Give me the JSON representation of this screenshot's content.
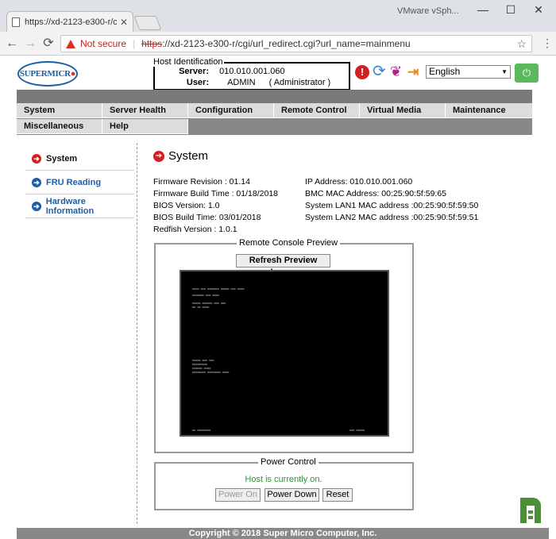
{
  "browser": {
    "tab_title": "https://xd-2123-e300-r/c",
    "user_label": "VMware vSph...",
    "security_label": "Not secure",
    "url_scheme": "https",
    "url_rest": "://xd-2123-e300-r/cgi/url_redirect.cgi?url_name=mainmenu"
  },
  "logo_text": "SUPERMICR",
  "host": {
    "legend": "Host Identification",
    "server_label": "Server:",
    "server_value": "010.010.001.060",
    "user_label": "User:",
    "user_value": "ADMIN",
    "user_role": "( Administrator )"
  },
  "language": {
    "selected": "English"
  },
  "menu": {
    "row1": [
      "System",
      "Server Health",
      "Configuration",
      "Remote Control",
      "Virtual Media",
      "Maintenance"
    ],
    "row2": [
      "Miscellaneous",
      "Help"
    ]
  },
  "sidebar": {
    "items": [
      {
        "label": "System"
      },
      {
        "label": "FRU Reading"
      },
      {
        "label": "Hardware Information"
      }
    ]
  },
  "page": {
    "title": "System",
    "left_info": [
      "Firmware Revision : 01.14",
      "Firmware Build Time : 01/18/2018",
      "BIOS Version: 1.0",
      "BIOS Build Time: 03/01/2018",
      "Redfish Version : 1.0.1"
    ],
    "right_info": [
      "IP Address: 010.010.001.060",
      "BMC MAC Address: 00:25:90:5f:59:65",
      "System LAN1 MAC address :00:25:90:5f:59:50",
      "System LAN2 MAC address :00:25:90:5f:59:51"
    ]
  },
  "console": {
    "legend": "Remote Console Preview",
    "refresh_label": "Refresh Preview Image"
  },
  "power": {
    "legend": "Power Control",
    "status": "Host is currently on.",
    "power_on_label": "Power On",
    "power_down_label": "Power Down",
    "reset_label": "Reset"
  },
  "footer": {
    "copyright": "Copyright © 2018 Super Micro Computer, Inc."
  },
  "colors": {
    "accent_blue": "#1b5fa8",
    "alert_red": "#d42020",
    "status_green": "#2a9a2a",
    "menu_gray": "#dcdcdc"
  }
}
